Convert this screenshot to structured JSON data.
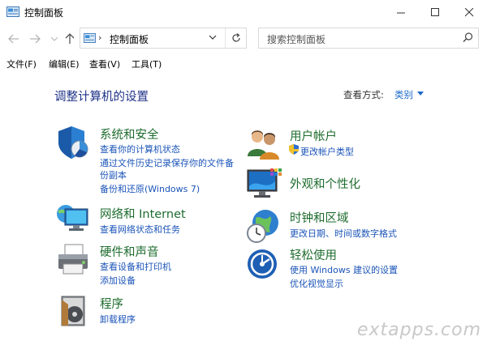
{
  "window": {
    "title": "控制面板"
  },
  "nav": {
    "address_path": "控制面板",
    "address_separator": "›",
    "search_placeholder": "搜索控制面板"
  },
  "menu": [
    "文件(F)",
    "编辑(E)",
    "查看(V)",
    "工具(T)"
  ],
  "main": {
    "heading": "调整计算机的设置",
    "view_by_label": "查看方式:",
    "view_by_value": "类别"
  },
  "categories": [
    {
      "title": "系统和安全",
      "links": [
        "查看你的计算机状态",
        "通过文件历史记录保存你的文件备",
        "份副本",
        "备份和还原(Windows 7)"
      ]
    },
    {
      "title": "网络和 Internet",
      "links": [
        "查看网络状态和任务"
      ]
    },
    {
      "title": "硬件和声音",
      "links": [
        "查看设备和打印机",
        "添加设备"
      ]
    },
    {
      "title": "程序",
      "links": [
        "卸载程序"
      ]
    },
    {
      "title": "用户帐户",
      "links": [
        "更改帐户类型"
      ]
    },
    {
      "title": "外观和个性化",
      "links": []
    },
    {
      "title": "时钟和区域",
      "links": [
        "更改日期、时间或数字格式"
      ]
    },
    {
      "title": "轻松使用",
      "links": [
        "使用 Windows 建议的设置",
        "优化视觉显示"
      ]
    }
  ],
  "watermark": "extapps.com",
  "colors": {
    "heading": "#1e3287",
    "category_title": "#1e6c2e",
    "link": "#1b54b8",
    "accent": "#1b6ac9"
  }
}
